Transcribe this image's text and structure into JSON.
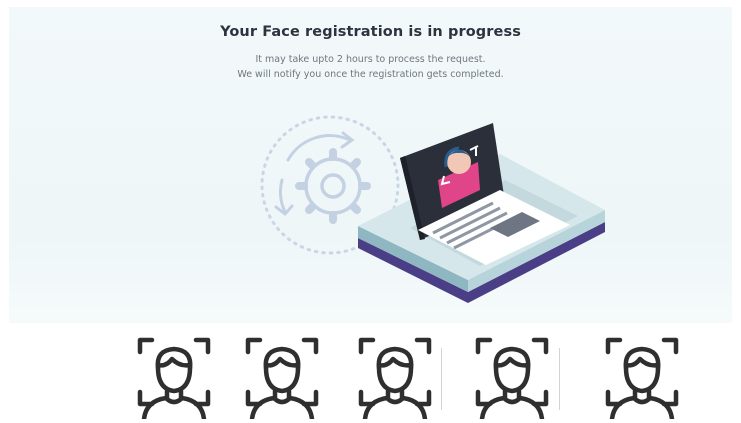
{
  "header": {
    "title": "Your Face registration is in progress",
    "line1": "It may take upto 2 hours to process the request.",
    "line2": "We will notify you once the registration gets completed."
  },
  "illustration": {
    "icons": [
      "gear-icon",
      "laptop-icon",
      "face-scan-icon"
    ]
  },
  "face_icons": {
    "count": 5,
    "icon": "face-scan-icon"
  },
  "colors": {
    "accent_pink": "#e0458a",
    "screen_dark": "#2b2f3a",
    "base_teal": "#9fc6cf",
    "base_purple": "#4a3f86",
    "gear_blue": "#c4d1e3"
  }
}
